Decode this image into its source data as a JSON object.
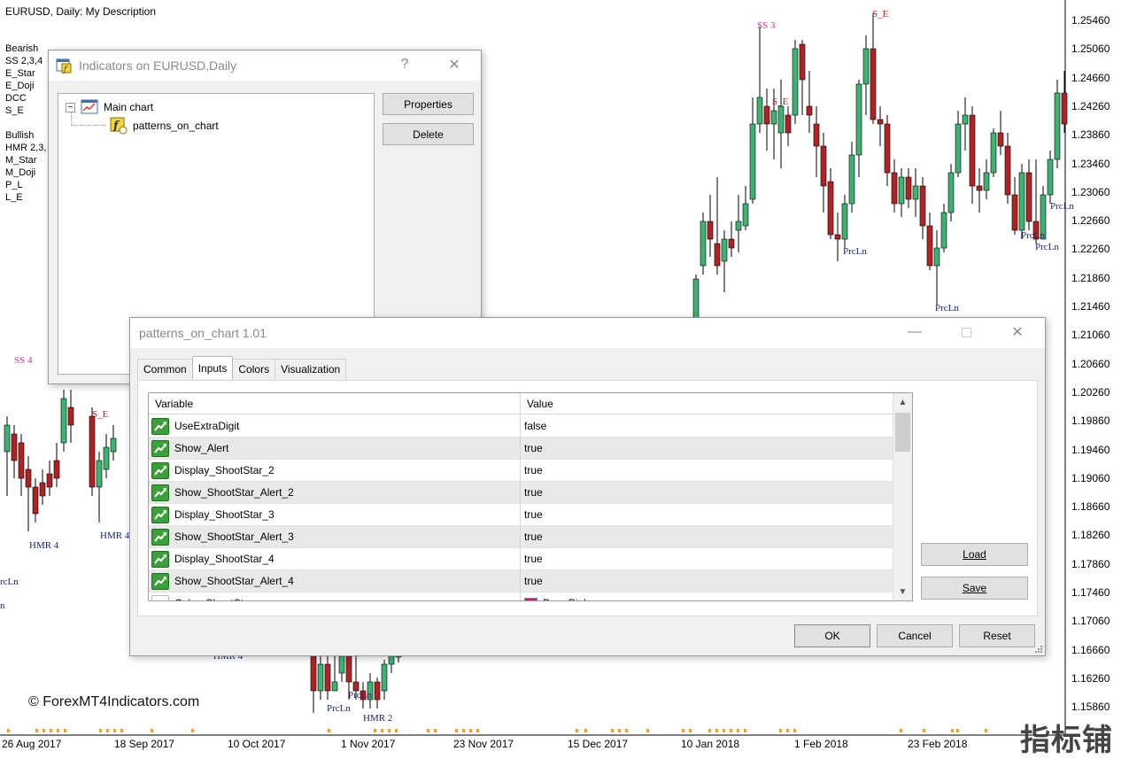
{
  "chart": {
    "title": "EURUSD, Daily:  My Description",
    "bearish_legend": [
      "Bearish",
      "SS 2,3,4",
      "E_Star",
      "E_Doji",
      "DCC",
      "S_E"
    ],
    "bullish_legend": [
      "Bullish",
      "HMR 2,3,",
      "M_Star",
      "M_Doji",
      "P_L",
      "L_E"
    ],
    "price_labels": [
      "1.25460",
      "1.25060",
      "1.24660",
      "1.24260",
      "1.23860",
      "1.23460",
      "1.23060",
      "1.22660",
      "1.22260",
      "1.21860",
      "1.21460",
      "1.21060",
      "1.20660",
      "1.20260",
      "1.19860",
      "1.19460",
      "1.19060",
      "1.18660",
      "1.18260",
      "1.17860",
      "1.17460",
      "1.17060",
      "1.16660",
      "1.16260",
      "1.15860"
    ],
    "date_labels": [
      "26 Aug 2017",
      "18 Sep 2017",
      "10 Oct 2017",
      "1 Nov 2017",
      "23 Nov 2017",
      "15 Dec 2017",
      "10 Jan 2018",
      "1 Feb 2018",
      "23 Feb 2018"
    ],
    "pattern_labels": {
      "ss3": "SS 3",
      "se_top": "S_E",
      "se_mid": "S_E",
      "ss4": "SS 4",
      "se_left": "S_E",
      "hmr4_a": "HMR 4",
      "hmr_b": "HMR 4",
      "hmr4_c": "HMR 4",
      "hmr2": "HMR 2",
      "prcln_1": "PrcLn",
      "prcln_2": "PrcLn",
      "prcln_3": "PrcLn",
      "prcln_4": "PrcLn",
      "prcln_5": "PrcLn",
      "prcln_6": "PrcLn",
      "prcln_7": "PrcLn",
      "prcln_left": "rcLn",
      "n_left": "n"
    },
    "bullish_color": "#3cb371",
    "bearish_color": "#b22222",
    "watermark": "© ForexMT4Indicators.com",
    "watermark_cn": "指标铺"
  },
  "indicators_dialog": {
    "title": "Indicators on EURUSD,Daily",
    "help": "?",
    "tree": {
      "root": "Main chart",
      "child": "patterns_on_chart"
    },
    "properties_label": "Properties",
    "delete_label": "Delete"
  },
  "props_dialog": {
    "title": "patterns_on_chart 1.01",
    "tabs": [
      "Common",
      "Inputs",
      "Colors",
      "Visualization"
    ],
    "active_tab": "Inputs",
    "columns": {
      "variable": "Variable",
      "value": "Value"
    },
    "rows": [
      {
        "variable": "UseExtraDigit",
        "value": "false"
      },
      {
        "variable": "Show_Alert",
        "value": "true"
      },
      {
        "variable": "Display_ShootStar_2",
        "value": "true"
      },
      {
        "variable": "Show_ShootStar_Alert_2",
        "value": "true"
      },
      {
        "variable": "Display_ShootStar_3",
        "value": "true"
      },
      {
        "variable": "Show_ShootStar_Alert_3",
        "value": "true"
      },
      {
        "variable": "Display_ShootStar_4",
        "value": "true"
      },
      {
        "variable": "Show_ShootStar_Alert_4",
        "value": "true"
      },
      {
        "variable": "Color_ShootStar",
        "value": "DeepPink"
      }
    ],
    "swatch_color": "#c81c78",
    "load_label": "Load",
    "save_label": "Save",
    "ok_label": "OK",
    "cancel_label": "Cancel",
    "reset_label": "Reset"
  }
}
